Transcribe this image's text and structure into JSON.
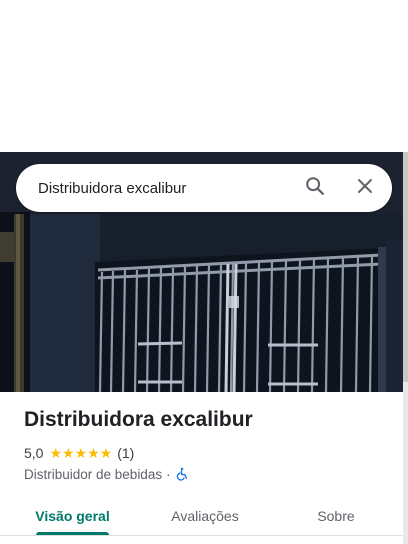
{
  "search": {
    "query": "Distribuidora excalibur",
    "search_icon": "search-icon",
    "close_icon": "close-icon"
  },
  "photo": {
    "subject": "shop-front-metal-gate"
  },
  "place": {
    "name": "Distribuidora excalibur",
    "rating": "5,0",
    "stars": "★★★★★",
    "star_color": "#fbbc04",
    "review_count": "(1)",
    "category": "Distribuidor de bebidas",
    "separator": "·",
    "accessibility_icon": "wheelchair-icon"
  },
  "tabs": [
    {
      "label": "Visão geral",
      "selected": true
    },
    {
      "label": "Avaliações",
      "selected": false
    },
    {
      "label": "Sobre",
      "selected": false
    }
  ],
  "colors": {
    "accent": "#00796b",
    "accessibility": "#1a73e8"
  }
}
